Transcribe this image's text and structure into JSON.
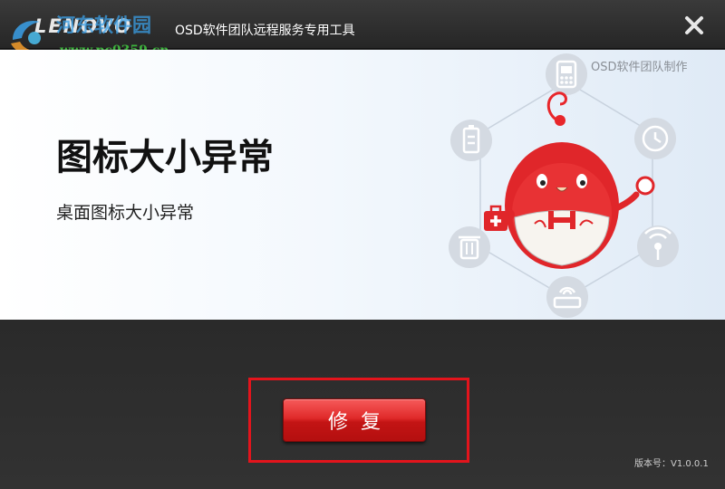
{
  "titlebar": {
    "brand": "LENOVO",
    "title": "OSD软件团队远程服务专用工具",
    "close_icon": "close-icon"
  },
  "watermark": {
    "name": "河东软件园",
    "url": "www.pc0359.cn"
  },
  "content": {
    "team_label": "OSD软件团队制作",
    "issue_title": "图标大小异常",
    "issue_desc": "桌面图标大小异常",
    "icons": [
      "phone-icon",
      "clock-icon",
      "magnify-icon",
      "wifi-icon",
      "router-icon",
      "trash-icon",
      "battery-icon",
      "medical-kit-icon"
    ]
  },
  "footer": {
    "repair_label": "修复",
    "version": "版本号：V1.0.0.1"
  },
  "colors": {
    "accent_red": "#e02a2a",
    "highlight_red": "#e3141c",
    "watermark_green": "#3cb23c",
    "watermark_blue": "#3aa0e8"
  }
}
